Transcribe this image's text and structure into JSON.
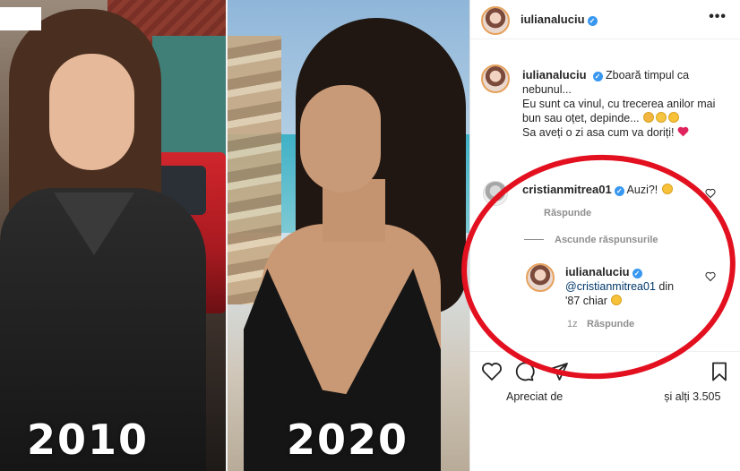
{
  "photo": {
    "year_left": "2010",
    "year_right": "2020"
  },
  "header": {
    "username": "iulianaluciu",
    "more_icon": "more-horizontal-icon"
  },
  "caption": {
    "username": "iulianaluciu",
    "line1": "Zboară timpul ca nebunul...",
    "line2": "Eu sunt ca vinul, cu trecerea anilor mai bun sau oțet, depinde...",
    "line3": "Sa aveți o zi asa cum va doriți!"
  },
  "comment": {
    "username": "cristianmitrea01",
    "text": "Auzi?!",
    "reply_label": "Răspunde"
  },
  "hide_replies_label": "Ascunde răspunsurile",
  "reply": {
    "username": "iulianaluciu",
    "mention": "@cristianmitrea01",
    "text_after_mention": "din",
    "text_line2": "'87 chiar",
    "time": "1z",
    "reply_label": "Răspunde"
  },
  "actions": {
    "like_icon": "heart-outline-icon",
    "comment_icon": "comment-icon",
    "share_icon": "share-icon",
    "save_icon": "bookmark-icon"
  },
  "likes": {
    "prefix": "Apreciat de",
    "suffix": "și alți 3.505"
  },
  "colors": {
    "verified": "#3897f0",
    "annotation": "#e3101f",
    "heart_red": "#e0245e",
    "muted_text": "#8e8e8e"
  }
}
